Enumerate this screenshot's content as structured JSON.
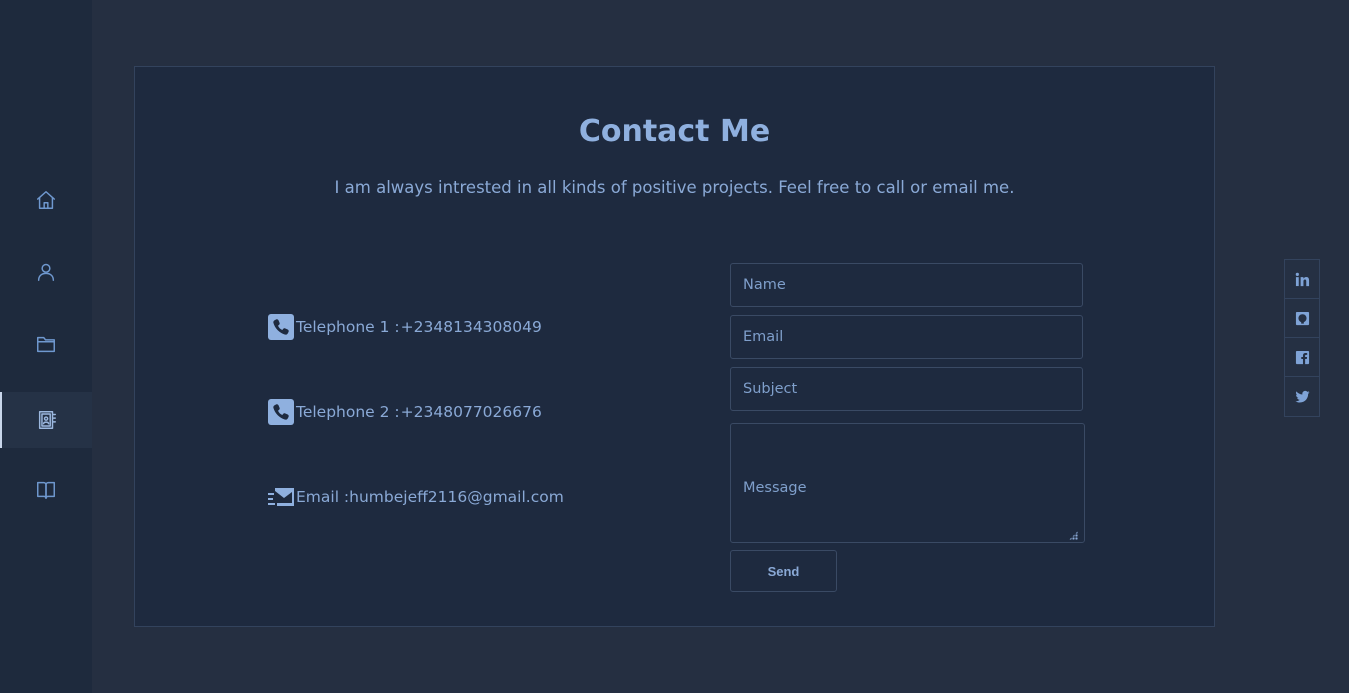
{
  "sidebar": {
    "items": [
      {
        "icon": "home-icon",
        "active": false
      },
      {
        "icon": "user-icon",
        "active": false
      },
      {
        "icon": "folder-icon",
        "active": false
      },
      {
        "icon": "contact-book-icon",
        "active": true
      },
      {
        "icon": "book-open-icon",
        "active": false
      }
    ]
  },
  "contact": {
    "title": "Contact Me",
    "subtitle": "I am always intrested in all kinds of positive projects. Feel free to call or email me.",
    "telephone1": {
      "label": "Telephone 1 :",
      "value": "+2348134308049"
    },
    "telephone2": {
      "label": "Telephone 2 :",
      "value": "+2348077026676"
    },
    "email": {
      "label": "Email :",
      "value": "humbejeff2116@gmail.com"
    }
  },
  "form": {
    "name_placeholder": "Name",
    "email_placeholder": "Email",
    "subject_placeholder": "Subject",
    "message_placeholder": "Message",
    "send_label": "Send"
  },
  "social": {
    "items": [
      "linkedin-icon",
      "github-icon",
      "facebook-icon",
      "twitter-icon"
    ]
  },
  "colors": {
    "background": "#252f41",
    "card": "#1e2a3f",
    "accent": "#8fb0df",
    "border": "#3a4a64"
  }
}
